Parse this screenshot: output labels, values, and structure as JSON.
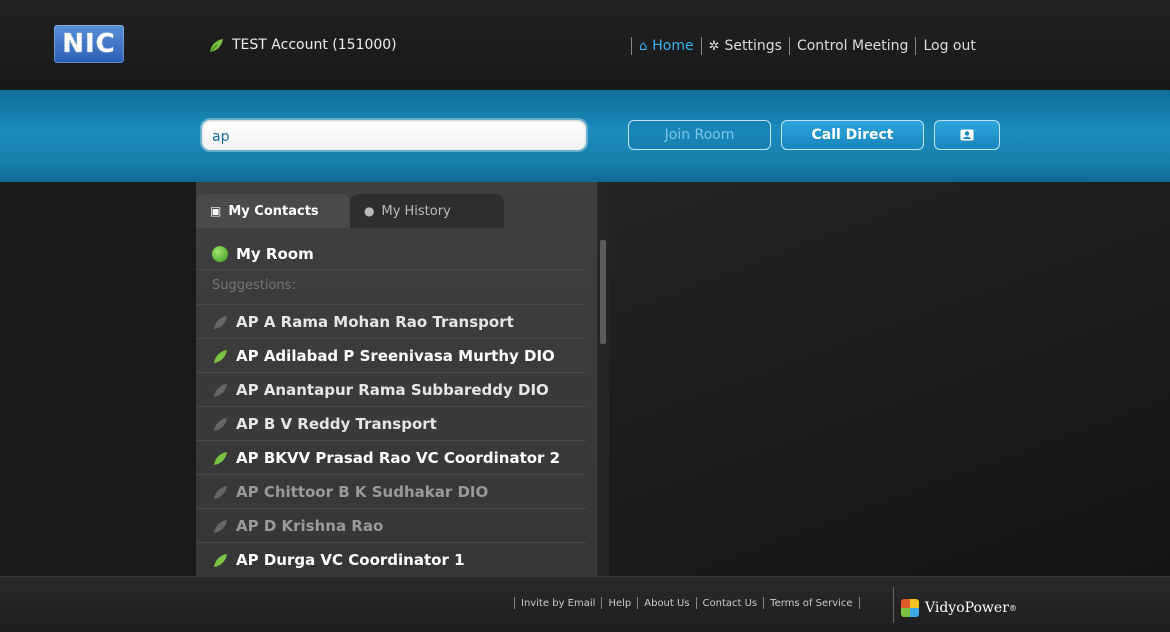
{
  "header": {
    "logo_text": "NIC",
    "account": "TEST Account (151000)",
    "nav": [
      {
        "label": "Home",
        "icon": "home-icon",
        "active": true
      },
      {
        "label": "Settings",
        "icon": "gear-icon",
        "active": false
      },
      {
        "label": "Control Meeting",
        "icon": "",
        "active": false
      },
      {
        "label": "Log out",
        "icon": "",
        "active": false
      }
    ]
  },
  "search": {
    "value": "ap",
    "join_label": "Join Room",
    "call_label": "Call Direct",
    "contact_icon": "contact-card-icon"
  },
  "tabs": {
    "contacts": "My Contacts",
    "history": "My History"
  },
  "my_room": "My Room",
  "suggestions_label": "Suggestions:",
  "contacts": [
    {
      "name": "AP A Rama Mohan Rao Transport",
      "status": "offline"
    },
    {
      "name": "AP Adilabad P Sreenivasa Murthy DIO",
      "status": "online"
    },
    {
      "name": "AP Anantapur Rama Subbareddy DIO",
      "status": "offline"
    },
    {
      "name": "AP B V Reddy Transport",
      "status": "offline"
    },
    {
      "name": "AP BKVV Prasad Rao VC Coordinator 2",
      "status": "online"
    },
    {
      "name": "AP Chittoor B K Sudhakar DIO",
      "status": "offline"
    },
    {
      "name": "AP D Krishna Rao",
      "status": "offline"
    },
    {
      "name": "AP Durga VC Coordinator 1",
      "status": "online"
    }
  ],
  "footer": {
    "links": [
      "Invite by Email",
      "Help",
      "About Us",
      "Contact Us",
      "Terms of Service"
    ],
    "brand": "VidyoPower"
  },
  "colors": {
    "accent_blue": "#3db2ee",
    "band_blue": "#1a8cbd",
    "online_green": "#7cc243",
    "offline_gray": "#666666"
  }
}
